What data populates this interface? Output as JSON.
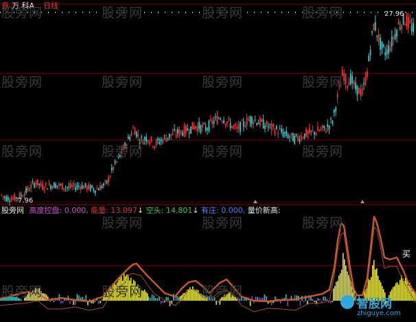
{
  "title_bar": {
    "prefix": "意",
    "stock": "万 科A",
    "period": "日线"
  },
  "price_panel": {
    "low_label": "7.96",
    "high_label": "27.96"
  },
  "indicator_bar": {
    "name": "股旁网",
    "items": [
      {
        "label": "高度控盘:",
        "value": "0.000,",
        "color": "#d14cd1"
      },
      {
        "label": "能量:",
        "value": "13.097",
        "color": "#e03030",
        "arrow": "↓"
      },
      {
        "label": "空头:",
        "value": "14.801",
        "color": "#30d030",
        "arrow": "↓"
      },
      {
        "label": "有庄:",
        "value": "0.000,",
        "color": "#5a7cff"
      },
      {
        "label": "量价新高:",
        "value": "",
        "color": "#e6e6e6"
      }
    ]
  },
  "annotations": {
    "buy_tag": "买"
  },
  "watermarks": {
    "site": "股旁网",
    "logo_text": "智股网",
    "logo_url": "zhiguye.com"
  },
  "colors": {
    "up": "#ff3232",
    "down": "#30d0d0",
    "grid": "#8b0000",
    "bar_yellow": "#f2f23a",
    "bar_cyan": "#30d0d0",
    "bar_purple": "#9b3fd6",
    "energy_line": "#e03030",
    "outline_line": "#d8a020"
  },
  "chart_data": {
    "type": "candlestick",
    "price_range": [
      7.96,
      27.96
    ],
    "price_path": [
      [
        0,
        8.5
      ],
      [
        8,
        8.1
      ],
      [
        18,
        8.0
      ],
      [
        30,
        8.3
      ],
      [
        40,
        8.9
      ],
      [
        52,
        9.8
      ],
      [
        62,
        9.3
      ],
      [
        80,
        9.5
      ],
      [
        100,
        9.2
      ],
      [
        118,
        9.4
      ],
      [
        140,
        9.0
      ],
      [
        155,
        9.6
      ],
      [
        165,
        11.3
      ],
      [
        175,
        12.6
      ],
      [
        185,
        14.0
      ],
      [
        195,
        15.6
      ],
      [
        205,
        14.2
      ],
      [
        215,
        14.6
      ],
      [
        225,
        13.8
      ],
      [
        240,
        14.5
      ],
      [
        255,
        15.0
      ],
      [
        270,
        15.3
      ],
      [
        285,
        15.8
      ],
      [
        300,
        15.5
      ],
      [
        310,
        16.2
      ],
      [
        322,
        16.8
      ],
      [
        335,
        16.0
      ],
      [
        345,
        15.4
      ],
      [
        355,
        16.0
      ],
      [
        365,
        16.6
      ],
      [
        378,
        16.2
      ],
      [
        392,
        15.7
      ],
      [
        405,
        15.3
      ],
      [
        418,
        14.8
      ],
      [
        430,
        14.4
      ],
      [
        445,
        14.9
      ],
      [
        460,
        15.2
      ],
      [
        475,
        15.5
      ],
      [
        485,
        16.4
      ],
      [
        492,
        19.0
      ],
      [
        500,
        21.6
      ],
      [
        505,
        20.3
      ],
      [
        510,
        21.0
      ],
      [
        518,
        19.8
      ],
      [
        528,
        19.3
      ],
      [
        535,
        21.6
      ],
      [
        540,
        24.3
      ],
      [
        545,
        26.9
      ],
      [
        550,
        25.6
      ],
      [
        555,
        24.3
      ],
      [
        562,
        23.6
      ],
      [
        570,
        24.6
      ],
      [
        580,
        26.5
      ],
      [
        590,
        27.2
      ],
      [
        600,
        26.3
      ],
      [
        606,
        25.8
      ]
    ],
    "indicator": {
      "energy_path": [
        [
          0,
          435
        ],
        [
          20,
          430
        ],
        [
          40,
          425
        ],
        [
          55,
          428
        ],
        [
          70,
          437
        ],
        [
          90,
          434
        ],
        [
          110,
          437
        ],
        [
          130,
          439
        ],
        [
          150,
          432
        ],
        [
          165,
          414
        ],
        [
          175,
          403
        ],
        [
          182,
          396
        ],
        [
          188,
          390
        ],
        [
          194,
          385
        ],
        [
          199,
          384
        ],
        [
          205,
          391
        ],
        [
          215,
          402
        ],
        [
          225,
          412
        ],
        [
          240,
          427
        ],
        [
          255,
          432
        ],
        [
          265,
          420
        ],
        [
          275,
          411
        ],
        [
          285,
          409
        ],
        [
          295,
          417
        ],
        [
          305,
          427
        ],
        [
          320,
          412
        ],
        [
          330,
          407
        ],
        [
          340,
          418
        ],
        [
          352,
          432
        ],
        [
          370,
          438
        ],
        [
          390,
          439
        ],
        [
          410,
          437
        ],
        [
          430,
          436
        ],
        [
          450,
          432
        ],
        [
          470,
          428
        ],
        [
          480,
          422
        ],
        [
          487,
          390
        ],
        [
          492,
          350
        ],
        [
          497,
          325
        ],
        [
          501,
          329
        ],
        [
          505,
          355
        ],
        [
          510,
          390
        ],
        [
          515,
          420
        ],
        [
          520,
          430
        ],
        [
          528,
          430
        ],
        [
          535,
          405
        ],
        [
          541,
          352
        ],
        [
          545,
          315
        ],
        [
          549,
          325
        ],
        [
          554,
          345
        ],
        [
          560,
          375
        ],
        [
          568,
          378
        ],
        [
          578,
          375
        ],
        [
          588,
          395
        ],
        [
          596,
          415
        ],
        [
          606,
          428
        ]
      ],
      "bars": [
        {
          "from": 0,
          "to": 30,
          "color": "cyan",
          "height": 10
        },
        {
          "from": 35,
          "to": 70,
          "color": "yellow",
          "height": 22
        },
        {
          "from": 150,
          "to": 215,
          "color": "yellow",
          "height": 42
        },
        {
          "from": 260,
          "to": 300,
          "color": "yellow",
          "height": 22
        },
        {
          "from": 320,
          "to": 345,
          "color": "yellow",
          "height": 14
        },
        {
          "from": 485,
          "to": 515,
          "color": "yellow",
          "height": 70
        },
        {
          "from": 530,
          "to": 560,
          "color": "yellow",
          "height": 60
        },
        {
          "from": 566,
          "to": 606,
          "color": "yellow",
          "height": 40
        }
      ]
    }
  }
}
